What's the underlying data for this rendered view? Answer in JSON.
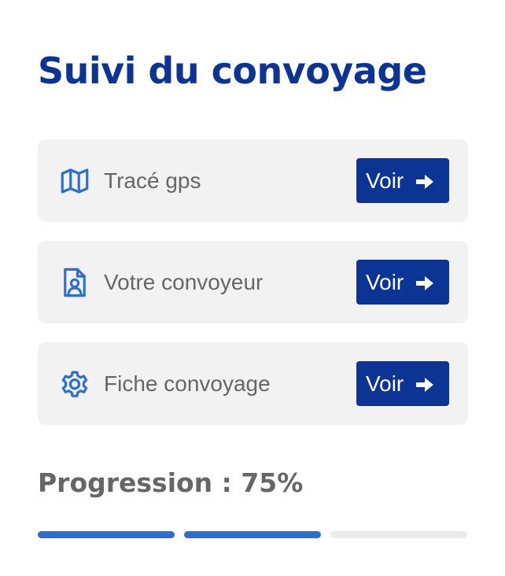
{
  "header": {
    "title": "Suivi du convoyage"
  },
  "items": [
    {
      "label": "Tracé gps",
      "icon": "map-icon",
      "button_label": "Voir"
    },
    {
      "label": "Votre convoyeur",
      "icon": "user-file-icon",
      "button_label": "Voir"
    },
    {
      "label": "Fiche convoyage",
      "icon": "gear-icon",
      "button_label": "Voir"
    }
  ],
  "progress": {
    "label": "Progression : 75%",
    "value_percent": 75,
    "segments_total": 3,
    "segments_filled": 2
  },
  "colors": {
    "title": "#0b3494",
    "button_bg": "#0b3494",
    "icon": "#2c6fd0",
    "card_bg": "#f2f2f2",
    "text_muted": "#666666",
    "segment_filled": "#2c6fd0",
    "segment_empty": "#ebebeb"
  }
}
